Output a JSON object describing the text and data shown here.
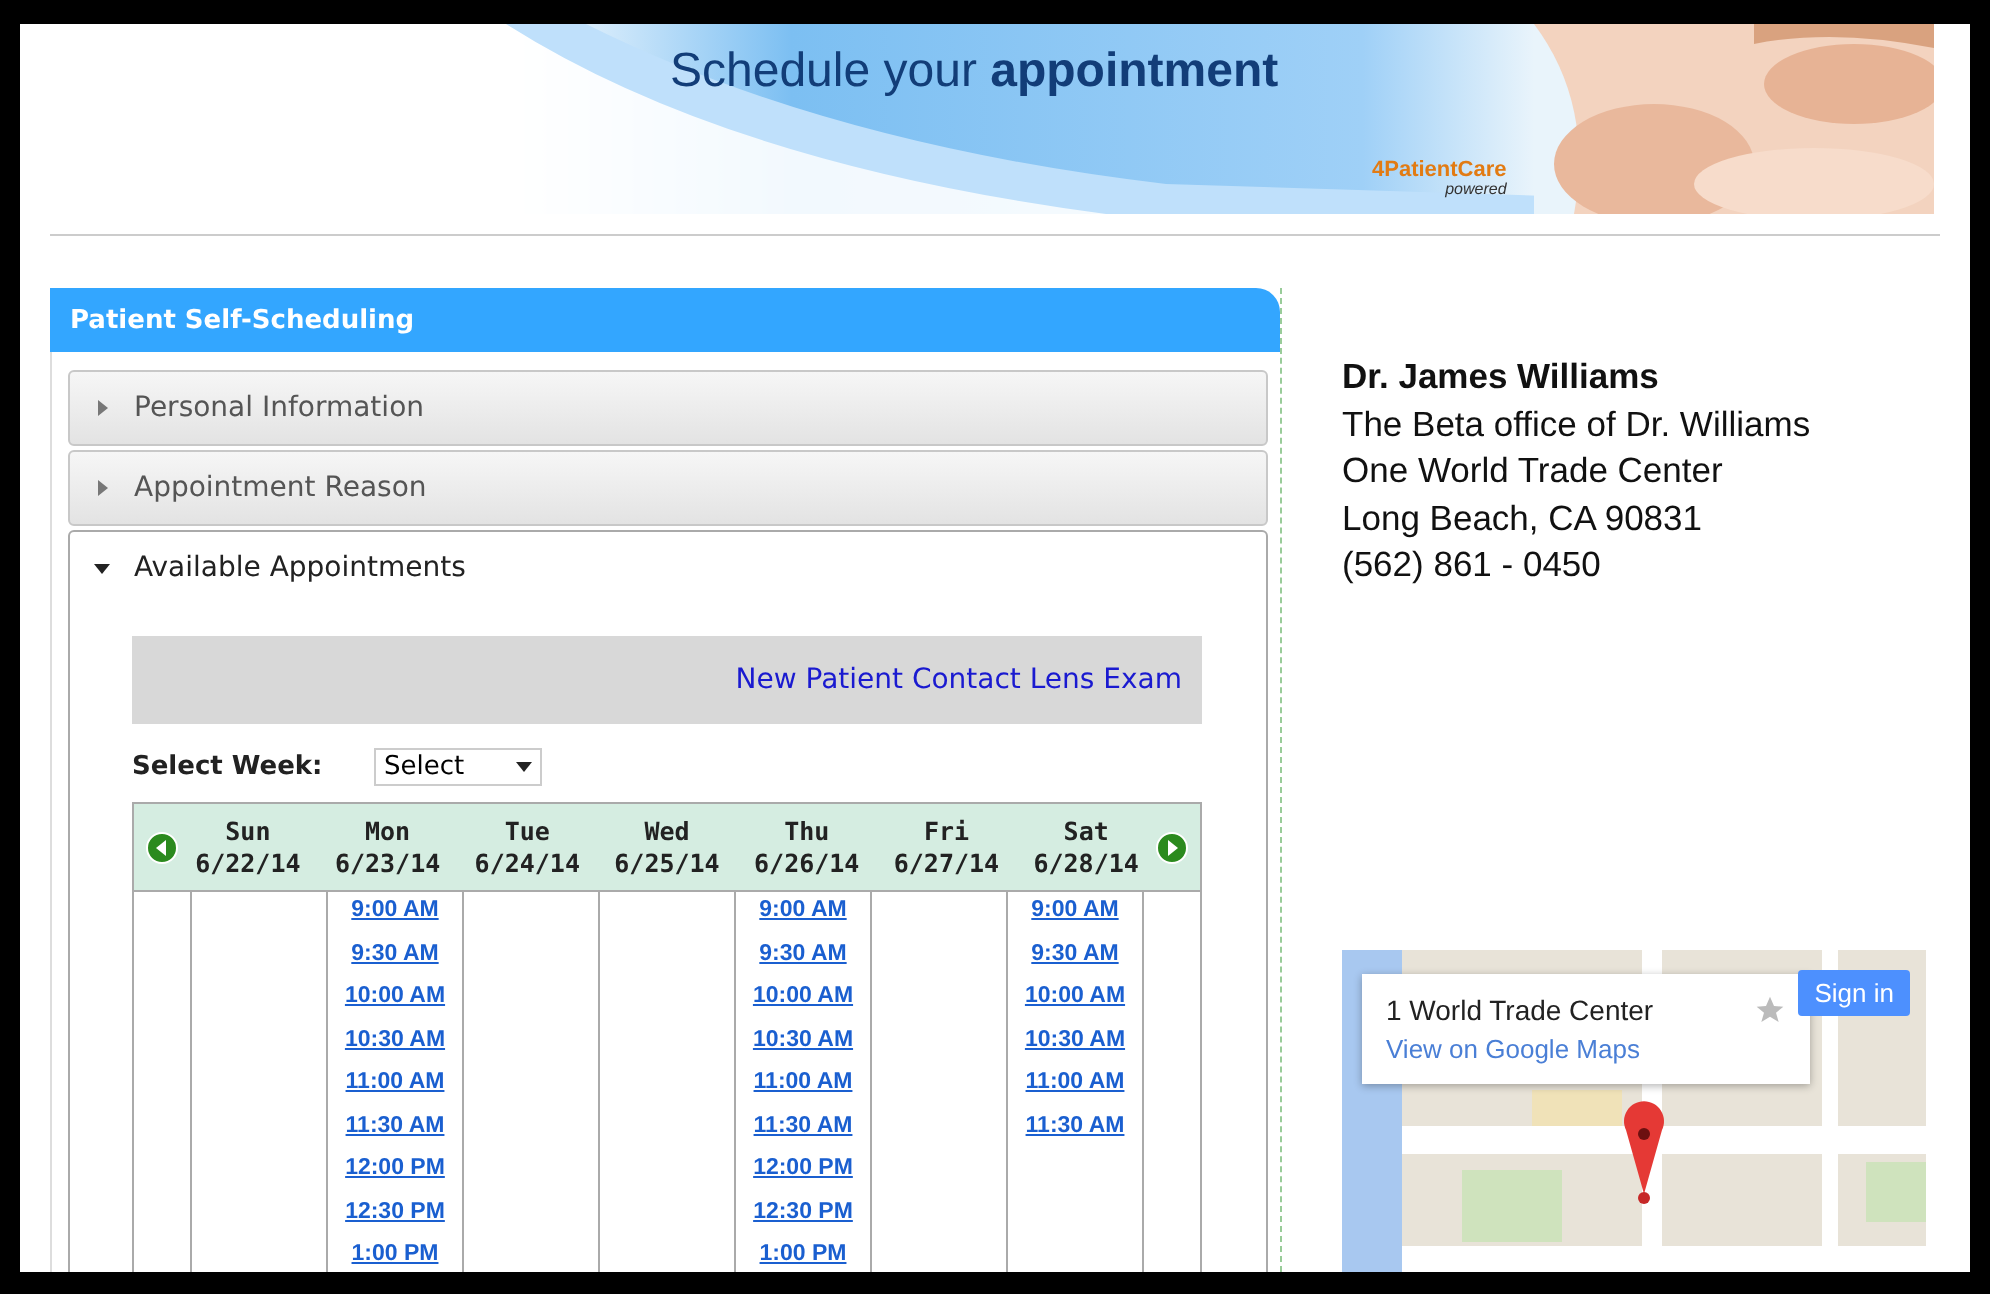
{
  "banner": {
    "headline": "Schedule your **appointment**",
    "logo": "4PatientCare",
    "logo_sub": "powered"
  },
  "panel": {
    "title": "Patient Self-Scheduling",
    "sections": [
      {
        "label": "Personal Information",
        "expanded": false
      },
      {
        "label": "Appointment Reason",
        "expanded": false
      },
      {
        "label": "Available Appointments",
        "expanded": true
      }
    ],
    "appointment_type": "New Patient Contact Lens Exam",
    "week_label": "Select Week:",
    "week_select": "Select",
    "days": [
      {
        "day": "Sun",
        "date": "6/22/14"
      },
      {
        "day": "Mon",
        "date": "6/23/14",
        "slots": [
          "9:00 AM",
          "9:30 AM",
          "10:00 AM",
          "10:30 AM",
          "11:00 AM",
          "11:30 AM",
          "12:00 PM",
          "12:30 PM",
          "1:00 PM"
        ]
      },
      {
        "day": "Tue",
        "date": "6/24/14"
      },
      {
        "day": "Wed",
        "date": "6/25/14"
      },
      {
        "day": "Thu",
        "date": "6/26/14",
        "slots": [
          "9:00 AM",
          "9:30 AM",
          "10:00 AM",
          "10:30 AM",
          "11:00 AM",
          "11:30 AM",
          "12:00 PM",
          "12:30 PM",
          "1:00 PM"
        ]
      },
      {
        "day": "Fri",
        "date": "6/27/14"
      },
      {
        "day": "Sat",
        "date": "6/28/14",
        "slots": [
          "9:00 AM",
          "9:30 AM",
          "10:00 AM",
          "10:30 AM",
          "11:00 AM",
          "11:30 AM"
        ]
      }
    ]
  },
  "contact": {
    "name": "Dr. James Williams",
    "lines": [
      "The Beta office of Dr. Williams",
      "One World Trade Center",
      "Long Beach, CA 90831",
      "(562) 861 - 0450"
    ]
  },
  "map": {
    "place": "1 World Trade Center",
    "link": "View on Google Maps",
    "sign_in": "Sign in",
    "starred": false
  }
}
